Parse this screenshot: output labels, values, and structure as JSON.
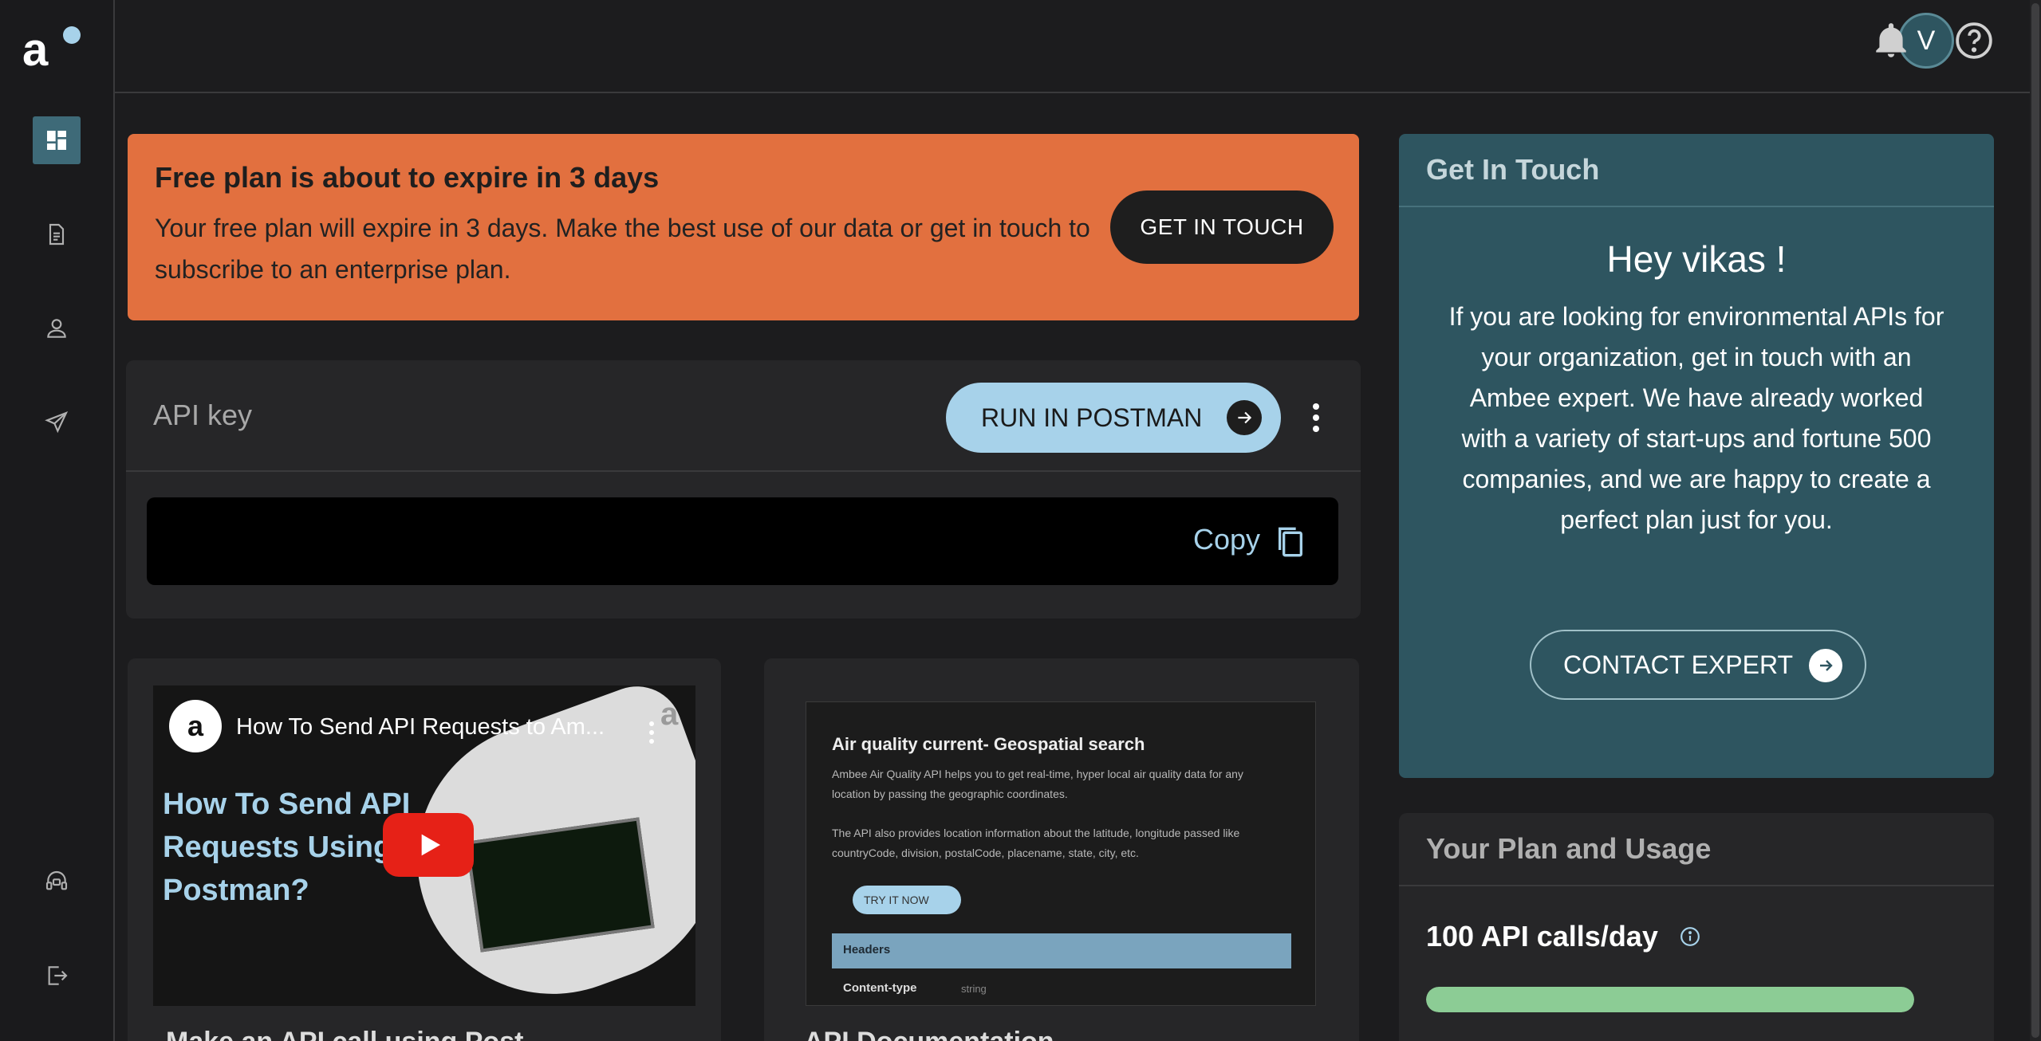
{
  "sidebar": {
    "logo_text": "a",
    "items": [
      {
        "name": "dashboard",
        "active": true
      },
      {
        "name": "documentation"
      },
      {
        "name": "profile"
      },
      {
        "name": "send"
      },
      {
        "name": "support"
      },
      {
        "name": "logout"
      }
    ]
  },
  "topbar": {
    "avatar_initial": "V",
    "icons": [
      "bell-icon",
      "help-icon"
    ]
  },
  "banner": {
    "title": "Free plan is about to expire in 3 days",
    "text": "Your free plan will expire in 3 days. Make the best use of our data or get in touch to subscribe to an enterprise plan.",
    "button": "GET IN TOUCH",
    "color": "#e2703f"
  },
  "api_key": {
    "title": "API key",
    "postman_button": "RUN IN POSTMAN",
    "copy_label": "Copy"
  },
  "video": {
    "logo": "a",
    "title": "How To Send API Requests to Am...",
    "headline": "How To Send API Requests Using Postman?",
    "corner_logo": "a",
    "caption": "Make an API call using Post..."
  },
  "doc_preview": {
    "title": "Air quality current- Geospatial search",
    "para1": "Ambee Air Quality API helps you to get real-time, hyper local air quality data for any location by passing the geographic coordinates.",
    "para2": "The API also provides location information about the latitude, longitude passed like countryCode, division, postalCode, placename, state, city, etc.",
    "try_button": "TRY IT NOW",
    "headers_label": "Headers",
    "content_type": "Content-type",
    "content_type_value": "string",
    "caption": "API Documentation"
  },
  "get_in_touch": {
    "heading": "Get In Touch",
    "greeting": "Hey vikas !",
    "body": "If you are looking for environmental APIs for your organization, get in touch with an Ambee expert. We have already worked with a variety of start-ups and fortune 500 companies, and we are happy to create a perfect plan just for you.",
    "button": "CONTACT EXPERT",
    "color": "#2e5560"
  },
  "plan": {
    "heading": "Your Plan and Usage",
    "calls": "100 API calls/day",
    "usage_fraction": 1.0,
    "bar_color": "#8ccc95"
  }
}
